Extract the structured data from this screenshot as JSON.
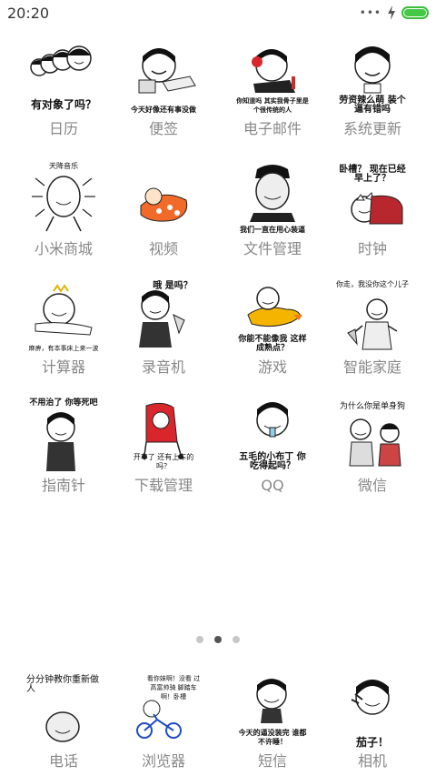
{
  "status_bar": {
    "time": "20:20",
    "battery_color": "#45c945"
  },
  "apps": [
    {
      "label": "日历",
      "caption": "有对象了吗？",
      "icon": "calendar-icon"
    },
    {
      "label": "便签",
      "caption": "今天好像还有事没做",
      "icon": "notes-icon"
    },
    {
      "label": "电子邮件",
      "caption": "你知道吗 其实我骨子里是个很传统的人",
      "icon": "email-icon"
    },
    {
      "label": "系统更新",
      "caption": "劳资辣么萌 装个逼有错吗",
      "icon": "system-update-icon"
    },
    {
      "label": "小米商城",
      "caption": "天降音乐",
      "icon": "mi-store-icon"
    },
    {
      "label": "视频",
      "caption": "",
      "icon": "video-icon"
    },
    {
      "label": "文件管理",
      "caption": "我们一直在用心装逼",
      "icon": "file-manager-icon"
    },
    {
      "label": "时钟",
      "caption": "卧槽？ 现在已经早上了？",
      "icon": "clock-icon"
    },
    {
      "label": "计算器",
      "caption": "麻痹，有本事床上来一波",
      "icon": "calculator-icon"
    },
    {
      "label": "录音机",
      "caption": "哦 是吗？",
      "icon": "recorder-icon"
    },
    {
      "label": "游戏",
      "caption": "你能不能像我 这样成熟点？",
      "icon": "game-icon"
    },
    {
      "label": "智能家庭",
      "caption": "你走，我没你这个儿子",
      "icon": "smart-home-icon"
    },
    {
      "label": "指南针",
      "caption": "不用治了 你等死吧",
      "icon": "compass-icon"
    },
    {
      "label": "下载管理",
      "caption": "开车了 还有上车的吗？",
      "icon": "download-manager-icon"
    },
    {
      "label": "QQ",
      "caption": "五毛的小布丁 你吃得起吗？",
      "icon": "qq-icon"
    },
    {
      "label": "微信",
      "caption": "为什么你是单身狗",
      "icon": "wechat-icon"
    }
  ],
  "page_indicator": {
    "count": 3,
    "active_index": 1
  },
  "dock": [
    {
      "label": "电话",
      "caption": "分分钟教你重新做人",
      "icon": "phone-icon"
    },
    {
      "label": "浏览器",
      "caption": "看你妹啊！没看 过高富帅骑 脚踏车啊！卧槽",
      "icon": "browser-icon"
    },
    {
      "label": "短信",
      "caption": "今天的逼没装完 谁都不许睡！",
      "icon": "messages-icon"
    },
    {
      "label": "相机",
      "caption": "茄子！",
      "icon": "camera-icon"
    }
  ]
}
